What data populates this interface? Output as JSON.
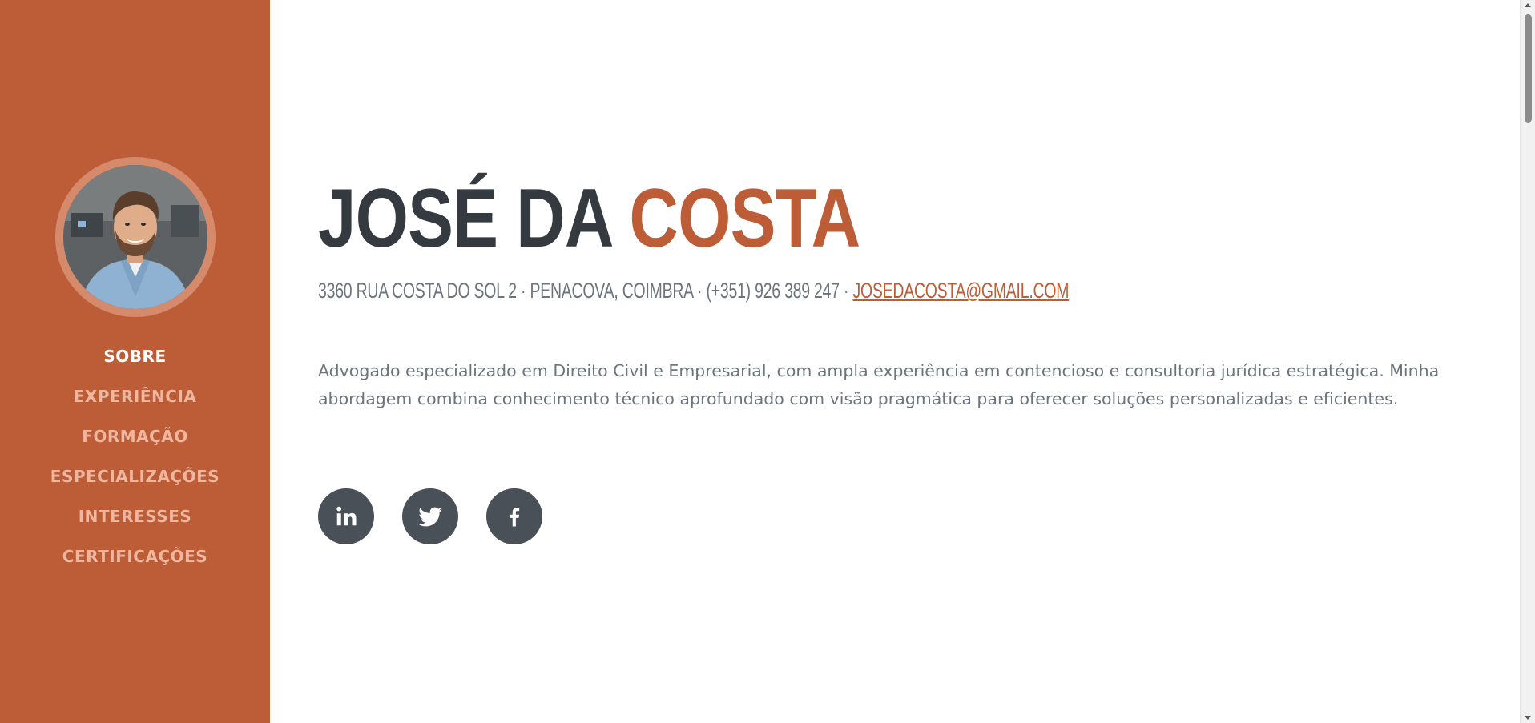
{
  "sidebar": {
    "avatar_alt": "Foto de perfil",
    "nav": [
      {
        "label": "SOBRE"
      },
      {
        "label": "EXPERIÊNCIA"
      },
      {
        "label": "FORMAÇÃO"
      },
      {
        "label": "ESPECIALIZAÇÕES"
      },
      {
        "label": "INTERESSES"
      },
      {
        "label": "CERTIFICAÇÕES"
      }
    ],
    "active_item": "SOBRE"
  },
  "about": {
    "first_name": "JOSÉ DA",
    "last_name": "COSTA",
    "contact_text": "3360 RUA COSTA DO SOL 2 · PENACOVA, COIMBRA · (+351) 926 389 247 · ",
    "email": "JOSEDACOSTA@GMAIL.COM",
    "description": "Advogado especializado em Direito Civil e Empresarial, com ampla experiência em contencioso e consultoria jurídica estratégica. Minha abordagem combina conhecimento técnico aprofundado com visão pragmática para oferecer soluções personalizadas e eficientes."
  },
  "social": [
    {
      "icon": "linkedin-icon"
    },
    {
      "icon": "twitter-icon"
    },
    {
      "icon": "facebook-icon"
    }
  ],
  "colors": {
    "primary": "#bd5d38",
    "nav_inactive": "#efb7a0",
    "heading": "#343a40",
    "body_text": "#6c757d",
    "social_bg": "#495057"
  }
}
